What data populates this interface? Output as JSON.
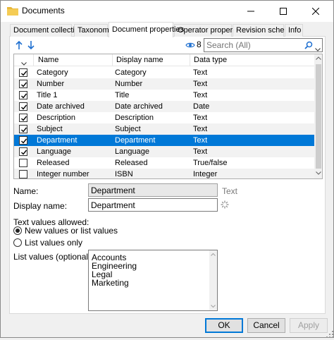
{
  "window": {
    "title": "Documents",
    "icon": "folder-icon"
  },
  "tabs": [
    {
      "label": "Document collection",
      "active": false
    },
    {
      "label": "Taxonomy",
      "active": false
    },
    {
      "label": "Document properties",
      "active": true
    },
    {
      "label": "Operator properties",
      "active": false
    },
    {
      "label": "Revision scheme",
      "active": false
    },
    {
      "label": "Info",
      "active": false
    }
  ],
  "toolbar": {
    "visible_count": "8",
    "search_placeholder": "Search (All)"
  },
  "grid": {
    "columns": [
      "Name",
      "Display name",
      "Data type"
    ],
    "rows": [
      {
        "checked": true,
        "name": "Category",
        "display": "Category",
        "type": "Text",
        "selected": false
      },
      {
        "checked": true,
        "name": "Number",
        "display": "Number",
        "type": "Text",
        "selected": false
      },
      {
        "checked": true,
        "name": "Title 1",
        "display": "Title",
        "type": "Text",
        "selected": false
      },
      {
        "checked": true,
        "name": "Date archived",
        "display": "Date archived",
        "type": "Date",
        "selected": false
      },
      {
        "checked": true,
        "name": "Description",
        "display": "Description",
        "type": "Text",
        "selected": false
      },
      {
        "checked": true,
        "name": "Subject",
        "display": "Subject",
        "type": "Text",
        "selected": false
      },
      {
        "checked": true,
        "name": "Department",
        "display": "Department",
        "type": "Text",
        "selected": true
      },
      {
        "checked": true,
        "name": "Language",
        "display": "Language",
        "type": "Text",
        "selected": false
      },
      {
        "checked": false,
        "name": "Released",
        "display": "Released",
        "type": "True/false",
        "selected": false
      },
      {
        "checked": false,
        "name": "Integer number",
        "display": "ISBN",
        "type": "Integer",
        "selected": false
      }
    ]
  },
  "details": {
    "name_label": "Name:",
    "name_value": "Department",
    "name_type": "Text",
    "display_label": "Display name:",
    "display_value": "Department",
    "text_values_label": "Text values allowed:",
    "option_new": "New values or list values",
    "option_list": "List values only",
    "list_label": "List values (optional):",
    "list_values": [
      "Accounts",
      "Engineering",
      "Legal",
      "Marketing"
    ]
  },
  "buttons": {
    "ok": "OK",
    "cancel": "Cancel",
    "apply": "Apply"
  },
  "colors": {
    "selection": "#0078d7",
    "window_bg": "#f0f0f0",
    "arrow_blue": "#1e6fd0"
  }
}
